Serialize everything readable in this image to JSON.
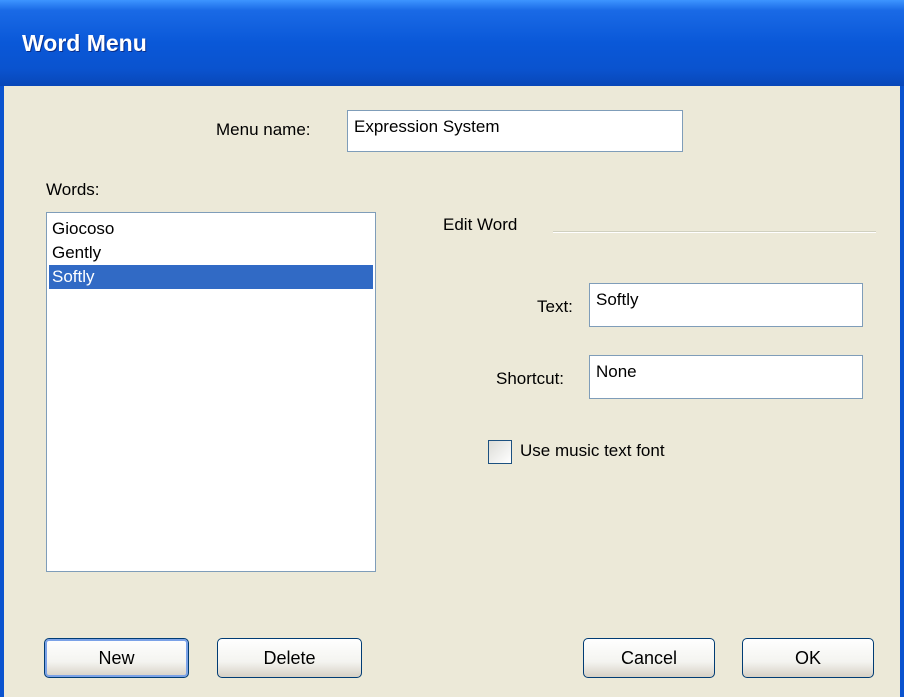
{
  "window": {
    "title": "Word Menu"
  },
  "menu_name": {
    "label": "Menu name:",
    "value": "Expression System"
  },
  "words": {
    "label": "Words:",
    "items": [
      "Giocoso",
      "Gently",
      "Softly"
    ],
    "selected_index": 2
  },
  "edit_word": {
    "group_label": "Edit Word",
    "text_label": "Text:",
    "text_value": "Softly",
    "shortcut_label": "Shortcut:",
    "shortcut_value": "None",
    "checkbox_label": "Use music text font",
    "checkbox_checked": false
  },
  "buttons": {
    "new": "New",
    "delete": "Delete",
    "cancel": "Cancel",
    "ok": "OK"
  }
}
